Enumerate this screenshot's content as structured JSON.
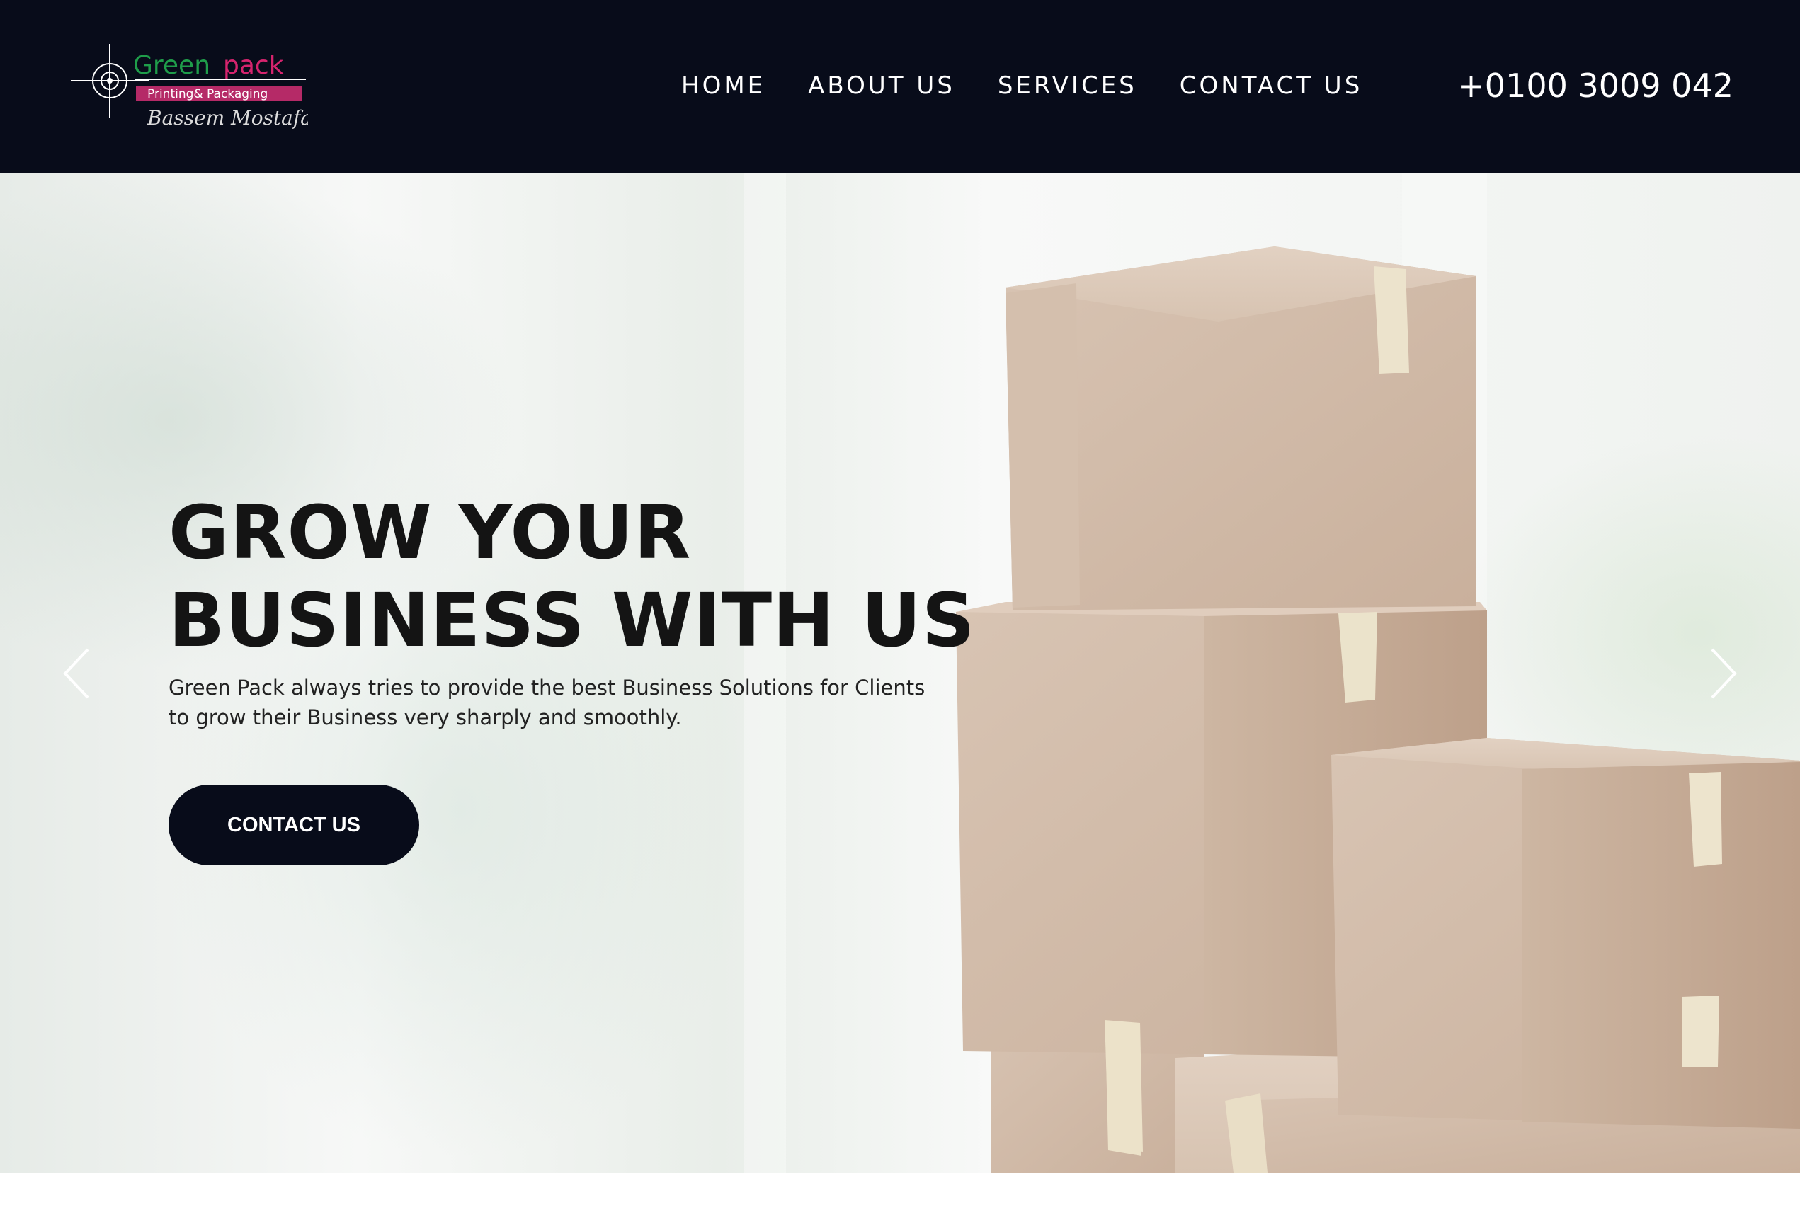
{
  "brand": {
    "logo_name": "Green pack",
    "logo_tagline": "Printing& Packaging",
    "logo_signature": "Bassem Mostafa",
    "colors": {
      "header_bg": "#080c1a",
      "logo_green": "#1f9d4a",
      "logo_pink": "#d6246e"
    }
  },
  "nav": {
    "items": [
      {
        "label": "HOME"
      },
      {
        "label": "ABOUT US"
      },
      {
        "label": "SERVICES"
      },
      {
        "label": "CONTACT US"
      }
    ]
  },
  "phone": "+0100 3009 042",
  "hero": {
    "title_line1": "GROW YOUR",
    "title_line2": "BUSINESS WITH US",
    "subtitle": "Green Pack always tries to provide the best Business Solutions for Clients to grow their Business very sharply and smoothly.",
    "cta_label": "CONTACT US",
    "prev_icon": "chevron-left-icon",
    "next_icon": "chevron-right-icon"
  }
}
